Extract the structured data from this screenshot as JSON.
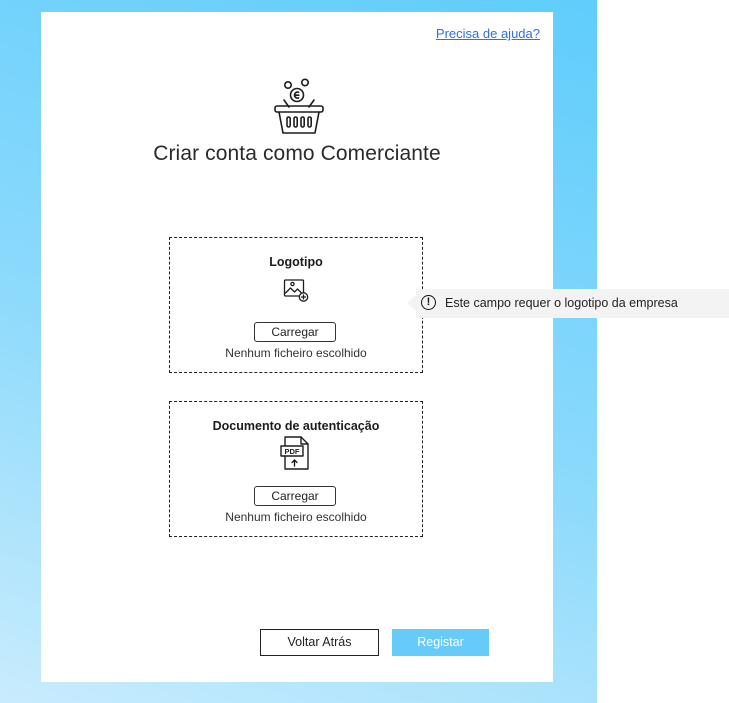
{
  "help_link": "Precisa de ajuda?",
  "title": "Criar conta como Comerciante",
  "logo_upload": {
    "label": "Logotipo",
    "button": "Carregar",
    "status": "Nenhum ficheiro escolhido"
  },
  "auth_upload": {
    "label": "Documento de autenticação",
    "button": "Carregar",
    "status": "Nenhum ficheiro escolhido",
    "pdf_text": "PDF"
  },
  "tooltip": {
    "icon": "!",
    "text": "Este campo requer o logotipo da empresa"
  },
  "actions": {
    "back": "Voltar Atrás",
    "register": "Registar"
  },
  "colors": {
    "accent": "#67cbf9",
    "link": "#2f6fe0",
    "background_gradient_top": "#5fcdfb",
    "background_gradient_bottom": "#c9ecfd"
  },
  "icons": {
    "header": "basket-with-coins-icon",
    "logo": "image-add-icon",
    "document": "pdf-upload-icon",
    "tooltip": "exclamation-circle-icon"
  }
}
